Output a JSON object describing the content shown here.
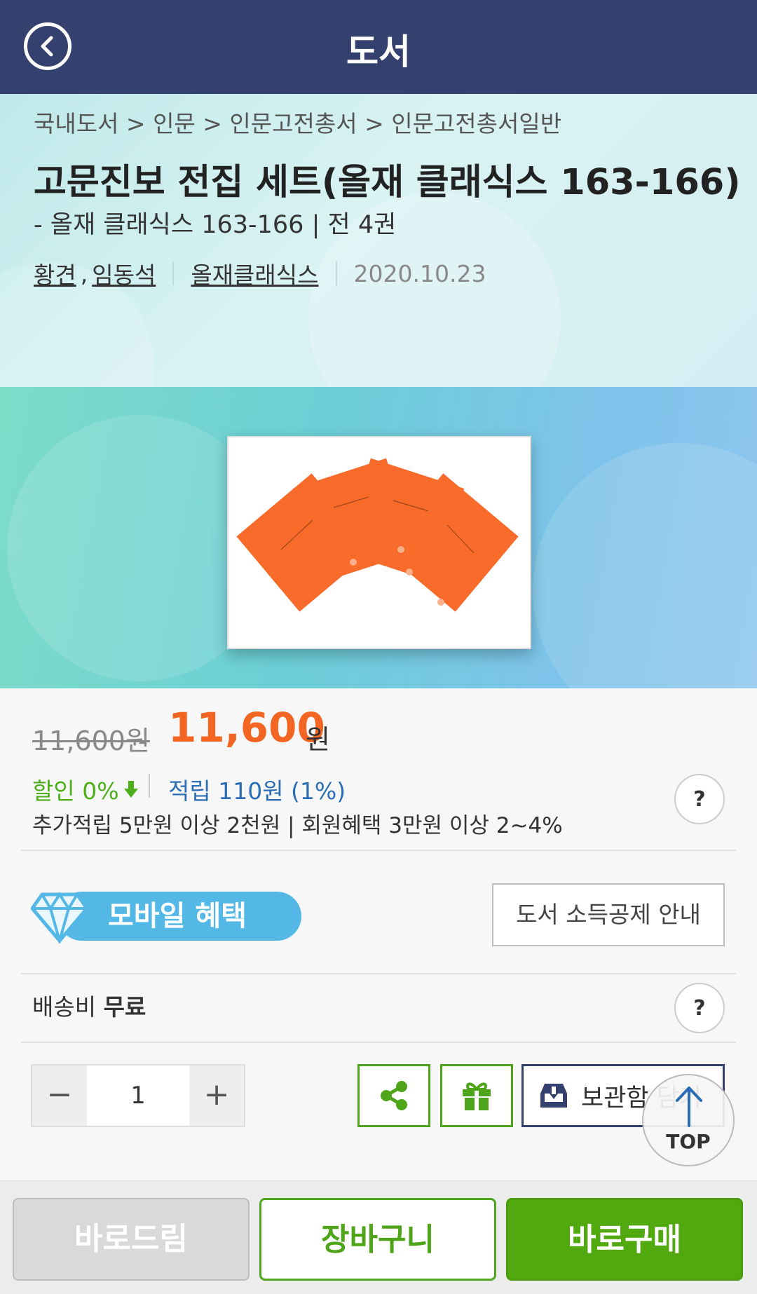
{
  "header": {
    "title": "도서"
  },
  "product": {
    "breadcrumb": "국내도서 > 인문 > 인문고전총서 > 인문고전총서일반",
    "title": "고문진보 전집 세트(올재 클래식스 163-166)",
    "subtitle": "- 올재 클래식스 163-166 | 전 4권",
    "author1": "황견",
    "author_sep": ",",
    "author2": "임동석",
    "publisher": "올재클래식스",
    "pub_date": "2020.10.23"
  },
  "price": {
    "original": "11,600원",
    "sale": "11,600",
    "won": "원",
    "discount": "할인 0%",
    "points": "적립 110원 (1%)",
    "extra": "추가적립 5만원 이상 2천원 | 회원혜택 3만원 이상 2~4%",
    "help": "?"
  },
  "benefits": {
    "mobile_label": "모바일 혜택",
    "deduction_label": "도서 소득공제 안내"
  },
  "shipping": {
    "label": "배송비",
    "value": "무료",
    "help": "?"
  },
  "purchase": {
    "qty_minus": "−",
    "qty_value": "1",
    "qty_plus": "+",
    "wishlist_label": "보관함 담기",
    "top_label": "TOP"
  },
  "bottom": {
    "gift_label": "바로드림",
    "cart_label": "장바구니",
    "buy_label": "바로구매"
  },
  "colors": {
    "header_bg": "#34406d",
    "sale_price": "#f26522",
    "discount": "#4caf1a",
    "points": "#2a6db5",
    "buy_button": "#52a80f",
    "book_cover": "#f96b2a"
  }
}
